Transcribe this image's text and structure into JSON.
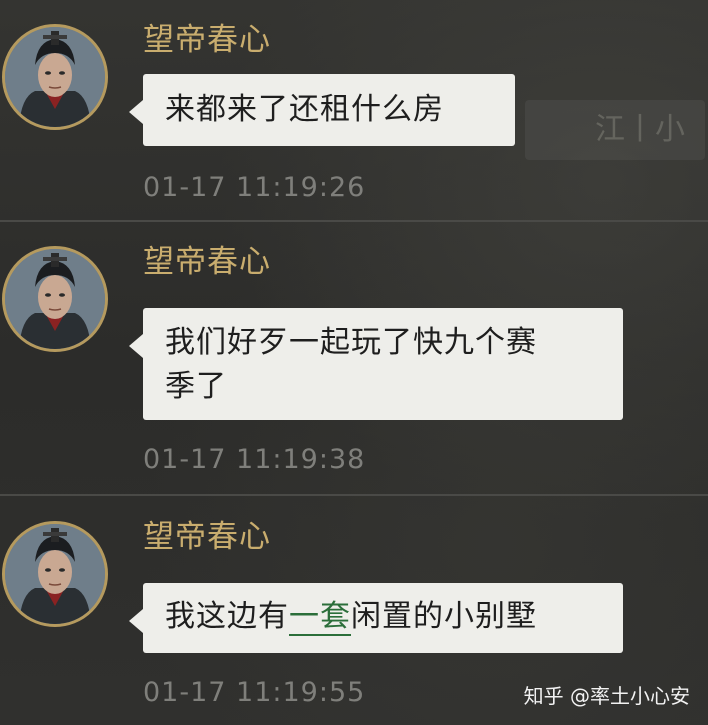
{
  "background_hint": {
    "text": "江丨小"
  },
  "messages": [
    {
      "sender": "望帝春心",
      "text": "来都来了还租什么房",
      "timestamp": "01-17 11:19:26"
    },
    {
      "sender": "望帝春心",
      "text_line1": "我们好歹一起玩了快九个赛",
      "text_line2": "季了",
      "timestamp": "01-17 11:19:38"
    },
    {
      "sender": "望帝春心",
      "text_before": "我这边有",
      "link_text": "一套",
      "text_after": "闲置的小别墅",
      "timestamp": "01-17 11:19:55"
    }
  ],
  "watermark": "知乎 @率土小心安",
  "colors": {
    "name": "#c9ad6e",
    "bubble": "#eeeeea",
    "link": "#2b6e3a",
    "timestamp": "#7f7f7b",
    "avatar_ring": "#b59a5e"
  }
}
